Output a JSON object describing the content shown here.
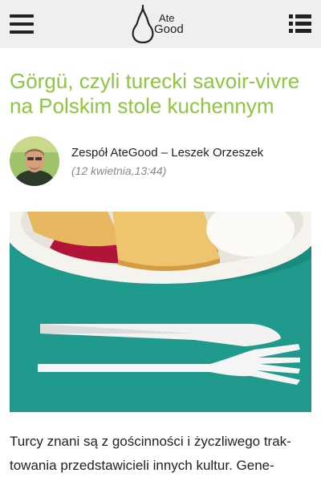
{
  "header": {
    "logo_line1": "Ate",
    "logo_line2": "Good",
    "menu_icon": "hamburger-menu-icon",
    "list_icon": "list-view-icon"
  },
  "article": {
    "title": "Görgü, czyli turecki savoir-vivre na Polskim stole kuchennym",
    "author": "Zespół AteGood – Leszek Orzeszek",
    "date": "(12 kwietnia,13:44)",
    "body_line1": "Turcy znani są z gościnności i życzliwego trak-",
    "body_line2": "towania przedstawicieli innych kultur. Gene-"
  },
  "colors": {
    "title_green": "#8dc63f",
    "topbar_bg": "#efefef",
    "hero_teal": "#1f9a8c"
  }
}
